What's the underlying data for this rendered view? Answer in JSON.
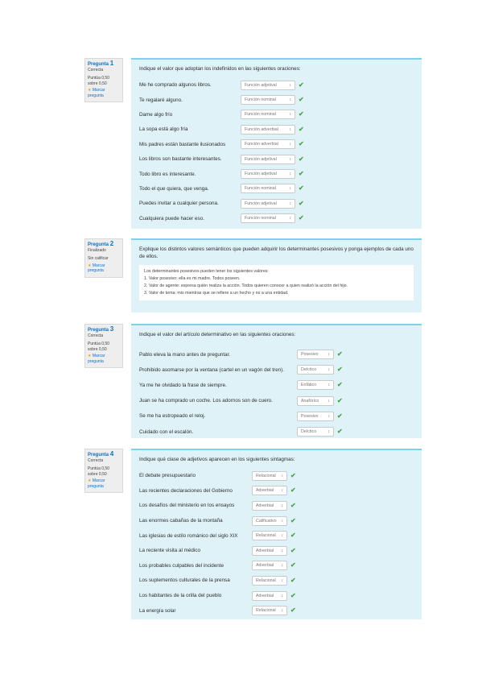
{
  "q1": {
    "info": {
      "label": "Pregunta",
      "number": "1",
      "status": "Correcta",
      "score": "Puntúa 0,50 sobre 0,50",
      "flag": "Marcar pregunta"
    },
    "prompt": "Indique el valor que adoptan los indefinidos en las siguientes oraciones:",
    "rows": [
      {
        "text": "Me he comprado algunos libros.",
        "answer": "Función adjetival"
      },
      {
        "text": "Te regalaré alguno.",
        "answer": "Función nominal"
      },
      {
        "text": "Dame algo frío",
        "answer": "Función nominal"
      },
      {
        "text": "La sopa está algo fría",
        "answer": "Función adverbial"
      },
      {
        "text": "Mis padres están bastante ilusionados",
        "answer": "Función adverbial"
      },
      {
        "text": "Los libros son bastante interesantes.",
        "answer": "Función adjetival"
      },
      {
        "text": "Todo libro es interesante.",
        "answer": "Función adjetival"
      },
      {
        "text": "Todo el que quiera, que venga.",
        "answer": "Función nominal"
      },
      {
        "text": "Puedes invitar a cualquier persona.",
        "answer": "Función adjetival"
      },
      {
        "text": "Cualquiera puede hacer eso.",
        "answer": "Función nominal"
      }
    ]
  },
  "q2": {
    "info": {
      "label": "Pregunta",
      "number": "2",
      "status": "Finalizado",
      "score": "Sin calificar",
      "flag": "Marcar pregunta"
    },
    "prompt": "Explique los distintos valores semánticos que pueden adquirir los determinantes posesivos y ponga ejemplos de cada uno de ellos.",
    "answer_lines": [
      "Los determinantes posesivos pueden tener los siguientes valores:",
      "1. Valor posesivo: ella es mi madre. Todos poseen.",
      "2. Valor de agente: expresa quién realiza la acción. Todos quieren conocer a quien realizó la acción del hijo.",
      "3. Valor de tema: mis mientras que se refiere a un hecho y no a una entidad."
    ]
  },
  "q3": {
    "info": {
      "label": "Pregunta",
      "number": "3",
      "status": "Correcta",
      "score": "Puntúa 0,50 sobre 0,50",
      "flag": "Marcar pregunta"
    },
    "prompt": "Indique el valor del artículo determinativo en las siguientes oraciones:",
    "rows": [
      {
        "text": "Pablo eleva la mano antes de preguntar.",
        "answer": "Posesivo"
      },
      {
        "text": "Prohibido asomarse por la ventana (cartel en un vagón del tren).",
        "answer": "Deíctico"
      },
      {
        "text": "Ya me he olvidado la frase de siempre.",
        "answer": "Enfático"
      },
      {
        "text": "Juan se ha comprado un coche. Los adornos son de cuero.",
        "answer": "Anafórico"
      },
      {
        "text": "Se me ha estropeado el reloj.",
        "answer": "Posesivo"
      },
      {
        "text": "Cuidado con el escalón.",
        "answer": "Deíctico"
      }
    ]
  },
  "q4": {
    "info": {
      "label": "Pregunta",
      "number": "4",
      "status": "Correcta",
      "score": "Puntúa 0,50 sobre 0,50",
      "flag": "Marcar pregunta"
    },
    "prompt": "Indique qué clase de adjetivos aparecen en los siguientes sintagmas:",
    "rows": [
      {
        "text": "El debate presupuestario",
        "answer": "Relacional"
      },
      {
        "text": "Las recientes declaraciones del Gobierno",
        "answer": "Adverbial"
      },
      {
        "text": "Los desafíos del ministerio en los ensayos",
        "answer": "Adverbial"
      },
      {
        "text": "Las enormes cabañas de la montaña",
        "answer": "Calificativo"
      },
      {
        "text": "Las iglesias de estilo románico del siglo XIX",
        "answer": "Relacional"
      },
      {
        "text": "La reciente visita al médico",
        "answer": "Adverbial"
      },
      {
        "text": "Los probables culpables del incidente",
        "answer": "Adverbial"
      },
      {
        "text": "Los suplementos culturales de la prensa",
        "answer": "Relacional"
      },
      {
        "text": "Los habitantes de la orilla del pueblo",
        "answer": "Adverbial"
      },
      {
        "text": "La energía solar",
        "answer": "Relacional"
      }
    ]
  },
  "colors": {
    "accent": "#0f6fc5",
    "panel": "#dff2f8",
    "panel_border": "#7fd0e8",
    "check": "#46a546",
    "info_bg": "#eeeeee"
  },
  "icons": {
    "check": "check-icon",
    "flag": "star-flag-icon",
    "dropdown": "dropdown-arrow-icon"
  }
}
